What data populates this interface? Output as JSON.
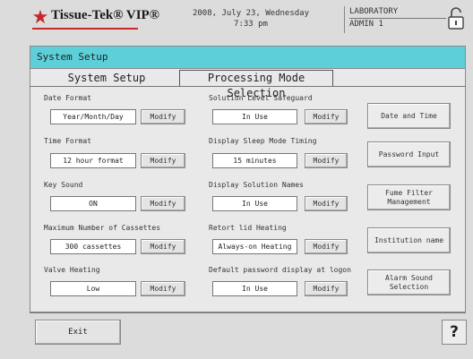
{
  "header": {
    "brand": "Tissue-Tek® VIP®",
    "date_line": "2008, July 23, Wednesday",
    "time_line": "7:33 pm",
    "location": "LABORATORY",
    "user": "ADMIN 1"
  },
  "window": {
    "title": "System Setup"
  },
  "tabs": [
    {
      "label": "System Setup",
      "active": true
    },
    {
      "label": "Processing Mode Selection",
      "active": false
    }
  ],
  "settings": {
    "col1": [
      {
        "label": "Date Format",
        "value": "Year/Month/Day",
        "button": "Modify"
      },
      {
        "label": "Time Format",
        "value": "12 hour format",
        "button": "Modify"
      },
      {
        "label": "Key Sound",
        "value": "ON",
        "button": "Modify"
      },
      {
        "label": "Maximum Number of Cassettes",
        "value": "300 cassettes",
        "button": "Modify"
      },
      {
        "label": "Valve Heating",
        "value": "Low",
        "button": "Modify"
      }
    ],
    "col2": [
      {
        "label": "Solution Level Safeguard",
        "value": "In Use",
        "button": "Modify"
      },
      {
        "label": "Display Sleep Mode Timing",
        "value": "15 minutes",
        "button": "Modify"
      },
      {
        "label": "Display Solution Names",
        "value": "In Use",
        "button": "Modify"
      },
      {
        "label": "Retort lid Heating",
        "value": "Always-on Heating",
        "button": "Modify"
      },
      {
        "label": "Default password display at logon",
        "value": "In Use",
        "button": "Modify"
      }
    ]
  },
  "side_buttons": {
    "date_time": "Date and Time",
    "password": "Password Input",
    "fume_filter": "Fume Filter\nManagement",
    "institution": "Institution name",
    "alarm_sound": "Alarm Sound\nSelection"
  },
  "footer": {
    "exit_label": "Exit",
    "help_label": "?"
  },
  "colors": {
    "titlebar": "#5dcfd8",
    "brand_red": "#c62828"
  }
}
